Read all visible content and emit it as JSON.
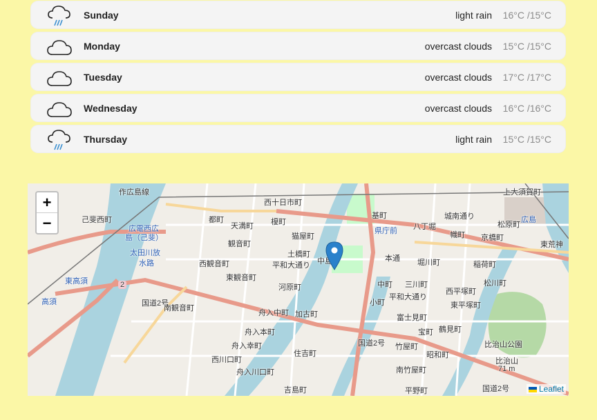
{
  "forecast": [
    {
      "day": "Sunday",
      "description": "light rain",
      "temps": "16°C /15°C",
      "icon": "rain-cloud-icon"
    },
    {
      "day": "Monday",
      "description": "overcast clouds",
      "temps": "15°C /15°C",
      "icon": "cloud-icon"
    },
    {
      "day": "Tuesday",
      "description": "overcast clouds",
      "temps": "17°C /17°C",
      "icon": "cloud-icon"
    },
    {
      "day": "Wednesday",
      "description": "overcast clouds",
      "temps": "16°C /16°C",
      "icon": "cloud-icon"
    },
    {
      "day": "Thursday",
      "description": "light rain",
      "temps": "15°C /15°C",
      "icon": "rain-cloud-icon"
    }
  ],
  "map": {
    "zoom_in": "+",
    "zoom_out": "−",
    "attribution": "Leaflet",
    "labels": [
      "作広島線",
      "西十日市町",
      "己斐西町",
      "広電西広",
      "島（己斐）",
      "都町",
      "天満町",
      "榎町",
      "猫屋町",
      "基町",
      "県庁前",
      "八丁堀",
      "城南通り",
      "幟町",
      "松原町",
      "広島",
      "京橋町",
      "東荒神",
      "太田川放",
      "水路",
      "観音町",
      "西観音町",
      "土橋町",
      "平和大通り",
      "中島",
      "本通",
      "堀川町",
      "稲荷町",
      "東観音町",
      "河原町",
      "中町",
      "三川町",
      "西平塚町",
      "松川町",
      "東高須",
      "高須",
      "国道2号",
      "南観音町",
      "舟入中町",
      "加古町",
      "小町",
      "平和大通り",
      "東平塚町",
      "比治山公園",
      "舟入本町",
      "富士見町",
      "宝町",
      "鶴見町",
      "舟入幸町",
      "国道2号",
      "竹屋町",
      "昭和町",
      "西川口町",
      "住吉町",
      "南竹屋町",
      "比治山",
      "71 m",
      "舟入川口町",
      "吉島町",
      "平野町",
      "国道2号",
      "上大須賀町",
      "2"
    ]
  },
  "colors": {
    "background": "#fbf7a6",
    "row_bg": "#f4f4f4",
    "temp_text": "#8a8a8a",
    "rain_drop": "#3a8fd0",
    "marker": "#2a81cb",
    "river": "#aad3df",
    "major_road": "#e89a8a"
  }
}
